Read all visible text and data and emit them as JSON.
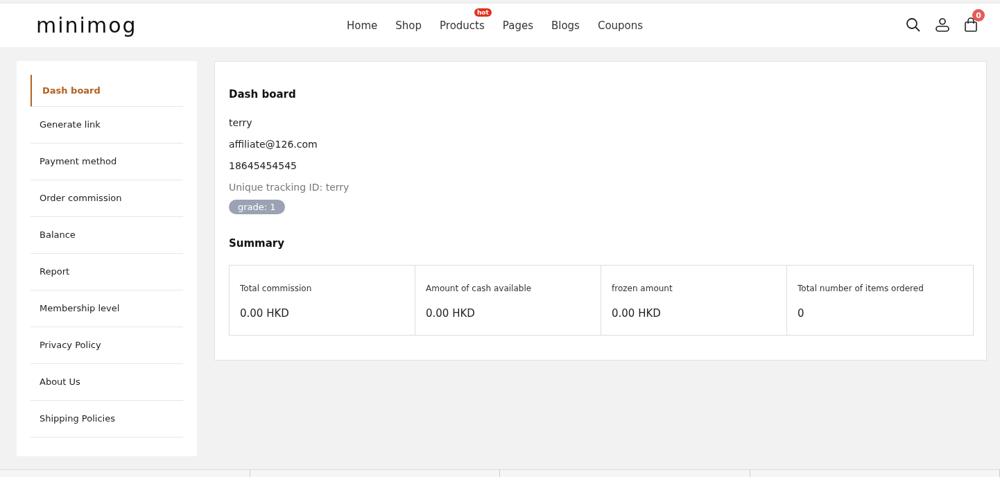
{
  "header": {
    "logo": "minimog",
    "nav": [
      {
        "label": "Home"
      },
      {
        "label": "Shop"
      },
      {
        "label": "Products",
        "badge": "hot"
      },
      {
        "label": "Pages"
      },
      {
        "label": "Blogs"
      },
      {
        "label": "Coupons"
      }
    ],
    "cart_count": "0"
  },
  "sidebar": {
    "items": [
      {
        "label": "Dash board",
        "selected": true
      },
      {
        "label": "Generate link",
        "selected": false
      },
      {
        "label": "Payment method",
        "selected": false
      },
      {
        "label": "Order commission",
        "selected": false
      },
      {
        "label": "Balance",
        "selected": false
      },
      {
        "label": "Report",
        "selected": false
      },
      {
        "label": "Membership level",
        "selected": false
      },
      {
        "label": "Privacy Policy",
        "selected": false
      },
      {
        "label": "About Us",
        "selected": false
      },
      {
        "label": "Shipping Policies",
        "selected": false
      }
    ]
  },
  "dashboard": {
    "title": "Dash board",
    "name": "terry",
    "email": "affiliate@126.com",
    "phone": "18645454545",
    "tracking": "Unique tracking ID: terry",
    "grade": "grade: 1"
  },
  "summary": {
    "title": "Summary",
    "cards": [
      {
        "label": "Total commission",
        "value": "0.00 HKD"
      },
      {
        "label": "Amount of cash available",
        "value": "0.00 HKD"
      },
      {
        "label": "frozen amount",
        "value": "0.00 HKD"
      },
      {
        "label": "Total number of items ordered",
        "value": "0"
      }
    ]
  }
}
